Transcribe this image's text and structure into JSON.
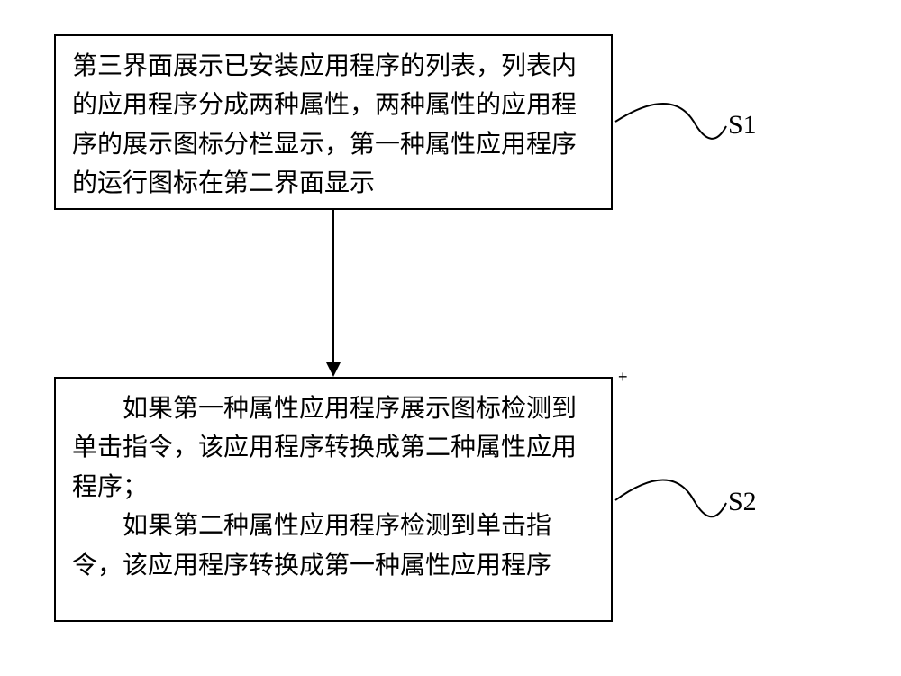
{
  "boxes": {
    "s1": {
      "text": "第三界面展示已安装应用程序的列表，列表内的应用程序分成两种属性，两种属性的应用程序的展示图标分栏显示，第一种属性应用程序的运行图标在第二界面显示"
    },
    "s2": {
      "para1": "如果第一种属性应用程序展示图标检测到单击指令，该应用程序转换成第二种属性应用程序；",
      "para2": "如果第二种属性应用程序检测到单击指令，该应用程序转换成第一种属性应用程序"
    }
  },
  "labels": {
    "s1": "S1",
    "s2": "S2"
  }
}
